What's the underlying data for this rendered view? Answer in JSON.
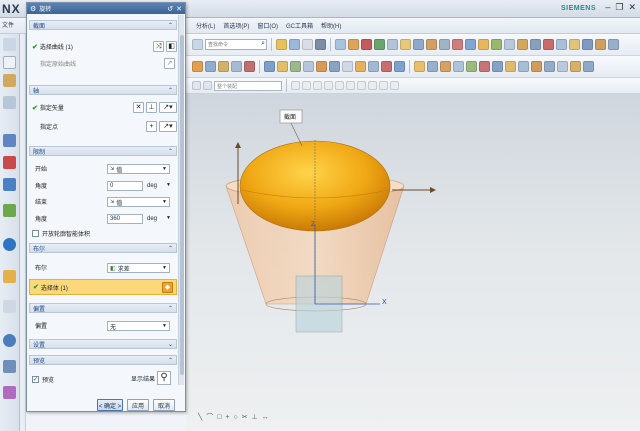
{
  "app": {
    "logo": "NX",
    "brand": "SIEMENS",
    "menu": [
      "分析(L)",
      "首选项(P)",
      "窗口(O)",
      "GC工具箱",
      "帮助(H)"
    ],
    "left_menu_label": "文件"
  },
  "toolbar": {
    "search_placeholder": "查找命令",
    "filter_placeholder": "整个装配"
  },
  "dialog": {
    "title": "旋转",
    "sections": {
      "section": {
        "header": "截面",
        "select_curve": "选择曲线 (1)",
        "specify_origin_curve": "指定原始曲线"
      },
      "axis": {
        "header": "轴",
        "specify_vector": "指定矢量",
        "specify_point": "指定点"
      },
      "limits": {
        "header": "限制",
        "start_label": "开始",
        "start_value": "值",
        "start_angle_label": "角度",
        "start_angle": "0",
        "end_label": "结束",
        "end_value": "值",
        "end_angle_label": "角度",
        "end_angle": "360",
        "unit": "deg",
        "open_profile_label": "开放轮廓智能体积"
      },
      "boolean": {
        "header": "布尔",
        "boolean_label": "布尔",
        "boolean_value": "求差",
        "select_body": "选择体 (1)"
      },
      "offset": {
        "header": "偏置",
        "offset_label": "偏置",
        "offset_value": "无"
      },
      "settings": {
        "header": "设置"
      },
      "preview": {
        "header": "预览",
        "preview_label": "预览",
        "show_result": "显示结果"
      }
    },
    "buttons": {
      "ok": "< 确定 >",
      "apply": "应用",
      "cancel": "取消"
    }
  },
  "viewport": {
    "tooltip": "截面",
    "axis_x": "X",
    "axis_z": "Z"
  }
}
